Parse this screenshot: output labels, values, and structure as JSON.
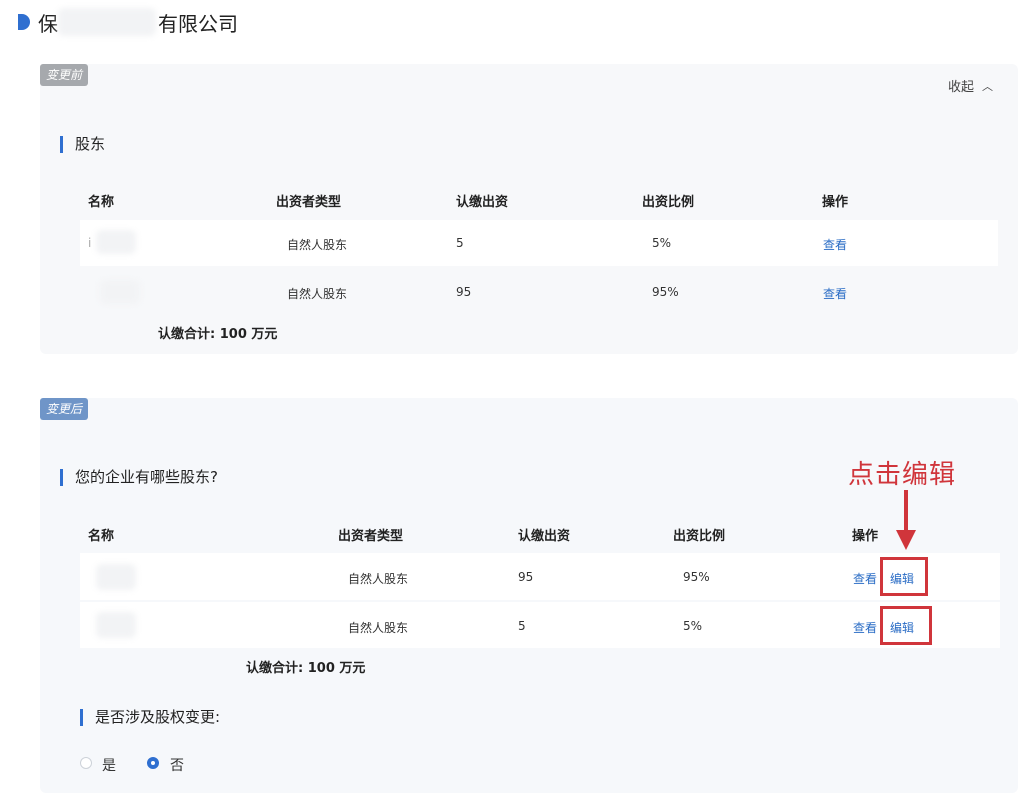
{
  "company": {
    "name_left": "保",
    "name_right": "有限公司"
  },
  "before": {
    "tag": "变更前",
    "collapse_label": "收起",
    "section_title": "股东",
    "columns": [
      "名称",
      "出资者类型",
      "认缴出资",
      "出资比例",
      "操作"
    ],
    "rows": [
      {
        "name": "i",
        "type": "自然人股东",
        "amount": "5",
        "ratio": "5%",
        "action": "查看"
      },
      {
        "name": "",
        "type": "自然人股东",
        "amount": "95",
        "ratio": "95%",
        "action": "查看"
      }
    ],
    "total": "认缴合计: 100 万元"
  },
  "after": {
    "tag": "变更后",
    "section_title": "您的企业有哪些股东?",
    "columns": [
      "名称",
      "出资者类型",
      "认缴出资",
      "出资比例",
      "操作"
    ],
    "rows": [
      {
        "type": "自然人股东",
        "amount": "95",
        "ratio": "95%",
        "view": "查看",
        "edit": "编辑"
      },
      {
        "type": "自然人股东",
        "amount": "5",
        "ratio": "5%",
        "view": "查看",
        "edit": "编辑"
      }
    ],
    "total": "认缴合计: 100 万元",
    "question": "是否涉及股权变更:",
    "options": [
      "是",
      "否"
    ],
    "selected_option": "否"
  },
  "annotation": {
    "text": "点击编辑",
    "color": "#d0353b"
  },
  "colors": {
    "accent": "#2f6fd0",
    "link": "#2a6cc5"
  }
}
